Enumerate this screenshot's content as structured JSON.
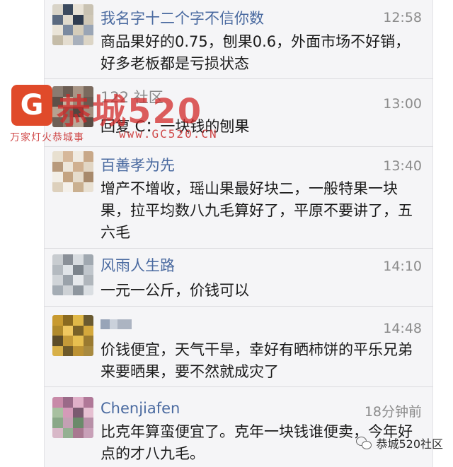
{
  "comments": [
    {
      "name": "我名字十二个字不信你数",
      "time": "12:58",
      "text": "商品果好的0.75，刨果0.6，外面市场不好销，好多老板都是亏损状态"
    },
    {
      "name": "122 社区",
      "time": "13:00",
      "text": "回复 C：一块钱的刨果"
    },
    {
      "name": "百善孝为先",
      "time": "13:40",
      "text": "增产不增收，瑶山果最好块二，一般特果一块果，拉平均数八九毛算好了，平原不要讲了，五六毛"
    },
    {
      "name": "风雨人生路",
      "time": "14:10",
      "text": "一元一公斤，价钱可以"
    },
    {
      "name": "",
      "time": "14:48",
      "text": "价钱便宜，天气干旱，幸好有晒柿饼的平乐兄弟来要晒果，要不然就成灾了"
    },
    {
      "name": "Chenjiafen",
      "time": "18分钟前",
      "text": "比克年算蛮便宜了。克年一块钱谁便卖，今年好点的才八九毛。"
    }
  ],
  "watermark": {
    "logo_letter": "G",
    "big_text": "恭城520",
    "sub_text": "万家灯火恭城事",
    "url": "www.GC520.CN",
    "bottom_text": "恭城520社区"
  }
}
